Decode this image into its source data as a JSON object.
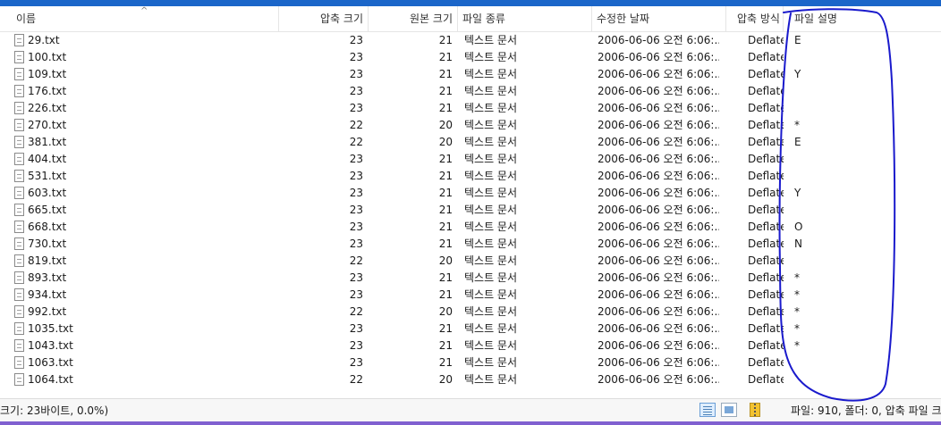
{
  "columns": {
    "name": "이름",
    "compressed": "압축 크기",
    "original": "원본 크기",
    "type": "파일 종류",
    "modified": "수정한 날짜",
    "method": "압축 방식",
    "description": "파일 설명"
  },
  "rows": [
    {
      "name": "29.txt",
      "compressed": "23",
      "original": "21",
      "type": "텍스트 문서",
      "modified": "2006-06-06 오전 6:06:...",
      "method": "Deflate",
      "description": "E"
    },
    {
      "name": "100.txt",
      "compressed": "23",
      "original": "21",
      "type": "텍스트 문서",
      "modified": "2006-06-06 오전 6:06:...",
      "method": "Deflate",
      "description": ""
    },
    {
      "name": "109.txt",
      "compressed": "23",
      "original": "21",
      "type": "텍스트 문서",
      "modified": "2006-06-06 오전 6:06:...",
      "method": "Deflate",
      "description": "Y"
    },
    {
      "name": "176.txt",
      "compressed": "23",
      "original": "21",
      "type": "텍스트 문서",
      "modified": "2006-06-06 오전 6:06:...",
      "method": "Deflate",
      "description": ""
    },
    {
      "name": "226.txt",
      "compressed": "23",
      "original": "21",
      "type": "텍스트 문서",
      "modified": "2006-06-06 오전 6:06:...",
      "method": "Deflate",
      "description": ""
    },
    {
      "name": "270.txt",
      "compressed": "22",
      "original": "20",
      "type": "텍스트 문서",
      "modified": "2006-06-06 오전 6:06:...",
      "method": "Deflate",
      "description": "*"
    },
    {
      "name": "381.txt",
      "compressed": "22",
      "original": "20",
      "type": "텍스트 문서",
      "modified": "2006-06-06 오전 6:06:...",
      "method": "Deflate",
      "description": "E"
    },
    {
      "name": "404.txt",
      "compressed": "23",
      "original": "21",
      "type": "텍스트 문서",
      "modified": "2006-06-06 오전 6:06:...",
      "method": "Deflate",
      "description": ""
    },
    {
      "name": "531.txt",
      "compressed": "23",
      "original": "21",
      "type": "텍스트 문서",
      "modified": "2006-06-06 오전 6:06:...",
      "method": "Deflate",
      "description": ""
    },
    {
      "name": "603.txt",
      "compressed": "23",
      "original": "21",
      "type": "텍스트 문서",
      "modified": "2006-06-06 오전 6:06:...",
      "method": "Deflate",
      "description": "Y"
    },
    {
      "name": "665.txt",
      "compressed": "23",
      "original": "21",
      "type": "텍스트 문서",
      "modified": "2006-06-06 오전 6:06:...",
      "method": "Deflate",
      "description": ""
    },
    {
      "name": "668.txt",
      "compressed": "23",
      "original": "21",
      "type": "텍스트 문서",
      "modified": "2006-06-06 오전 6:06:...",
      "method": "Deflate",
      "description": "O"
    },
    {
      "name": "730.txt",
      "compressed": "23",
      "original": "21",
      "type": "텍스트 문서",
      "modified": "2006-06-06 오전 6:06:...",
      "method": "Deflate",
      "description": "N"
    },
    {
      "name": "819.txt",
      "compressed": "22",
      "original": "20",
      "type": "텍스트 문서",
      "modified": "2006-06-06 오전 6:06:...",
      "method": "Deflate",
      "description": ""
    },
    {
      "name": "893.txt",
      "compressed": "23",
      "original": "21",
      "type": "텍스트 문서",
      "modified": "2006-06-06 오전 6:06:...",
      "method": "Deflate",
      "description": "*"
    },
    {
      "name": "934.txt",
      "compressed": "23",
      "original": "21",
      "type": "텍스트 문서",
      "modified": "2006-06-06 오전 6:06:...",
      "method": "Deflate",
      "description": "*"
    },
    {
      "name": "992.txt",
      "compressed": "22",
      "original": "20",
      "type": "텍스트 문서",
      "modified": "2006-06-06 오전 6:06:...",
      "method": "Deflate",
      "description": "*"
    },
    {
      "name": "1035.txt",
      "compressed": "23",
      "original": "21",
      "type": "텍스트 문서",
      "modified": "2006-06-06 오전 6:06:...",
      "method": "Deflate",
      "description": "*"
    },
    {
      "name": "1043.txt",
      "compressed": "23",
      "original": "21",
      "type": "텍스트 문서",
      "modified": "2006-06-06 오전 6:06:...",
      "method": "Deflate",
      "description": "*"
    },
    {
      "name": "1063.txt",
      "compressed": "23",
      "original": "21",
      "type": "텍스트 문서",
      "modified": "2006-06-06 오전 6:06:...",
      "method": "Deflate",
      "description": ""
    },
    {
      "name": "1064.txt",
      "compressed": "22",
      "original": "20",
      "type": "텍스트 문서",
      "modified": "2006-06-06 오전 6:06:...",
      "method": "Deflate",
      "description": ""
    }
  ],
  "status": {
    "left": "크기: 23바이트, 0.0%)",
    "right": "파일: 910, 폴더: 0, 압축 파일 크"
  },
  "icons": {
    "file": "text-file-icon",
    "sort": "sort-ascending-arrow-icon",
    "details_view": "details-view-icon",
    "thumbnail_view": "thumbnail-view-icon",
    "archive": "zip-archive-icon"
  },
  "colors": {
    "title_bar": "#1b66c9",
    "annotation": "#1a1acc",
    "bottom_bar": "#8060d0"
  }
}
